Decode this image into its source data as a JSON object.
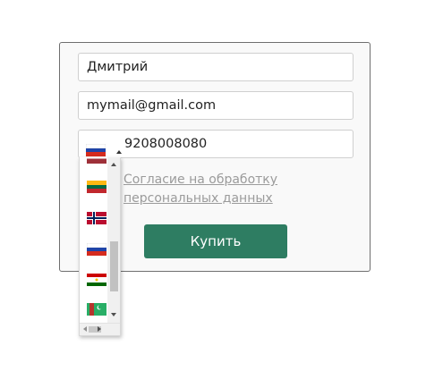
{
  "form": {
    "name_value": "Дмитрий",
    "email_value": "mymail@gmail.com",
    "phone_value": "9208008080",
    "consent_text": "Согласие на обработку персональных данных",
    "buy_label": "Купить"
  },
  "phone_selected_country": "russia-flag-icon",
  "country_list": [
    "latvia-flag-icon",
    "lithuania-flag-icon",
    "norway-flag-icon",
    "russia-flag-icon",
    "tajikistan-flag-icon",
    "turkmenistan-flag-icon"
  ],
  "colors": {
    "accent": "#2e7d62"
  }
}
